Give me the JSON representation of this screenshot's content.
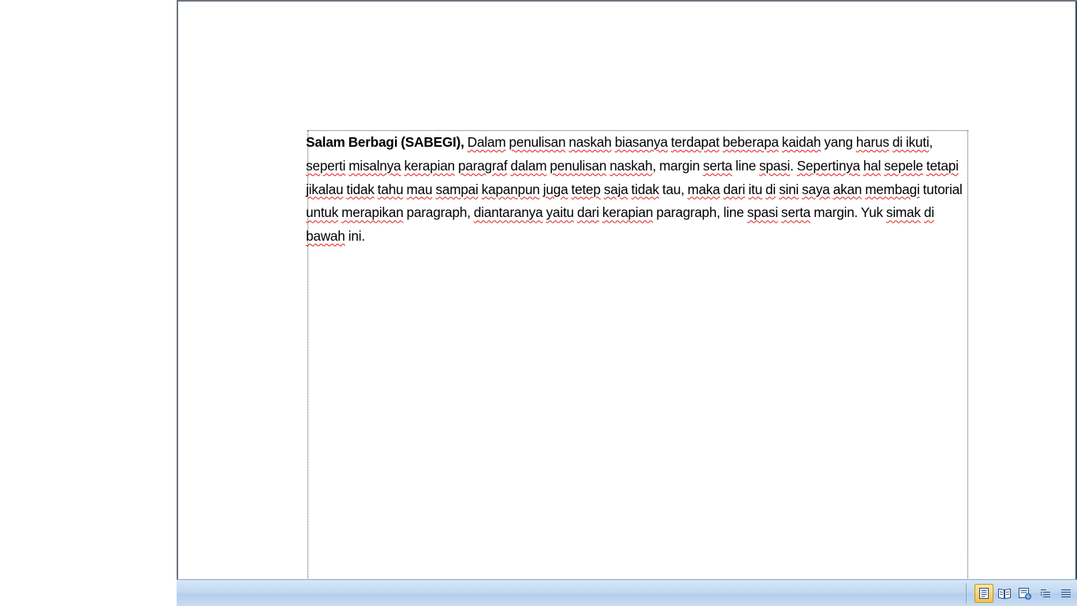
{
  "document": {
    "paragraph": {
      "bold_lead": "Salam Berbagi (SABEGI),",
      "words": [
        {
          "t": " ",
          "s": false
        },
        {
          "t": "Dalam",
          "s": true
        },
        {
          "t": " ",
          "s": false
        },
        {
          "t": "penulisan",
          "s": true
        },
        {
          "t": " ",
          "s": false
        },
        {
          "t": "naskah",
          "s": true
        },
        {
          "t": " ",
          "s": false
        },
        {
          "t": "biasanya",
          "s": true
        },
        {
          "t": " ",
          "s": false
        },
        {
          "t": "terdapat",
          "s": true
        },
        {
          "t": " ",
          "s": false
        },
        {
          "t": "beberapa",
          "s": true
        },
        {
          "t": " ",
          "s": false
        },
        {
          "t": "kaidah",
          "s": true
        },
        {
          "t": " yang ",
          "s": false
        },
        {
          "t": "harus",
          "s": true
        },
        {
          "t": " ",
          "s": false
        },
        {
          "t": "di ikuti",
          "s": true
        },
        {
          "t": ", ",
          "s": false
        },
        {
          "t": "seperti",
          "s": true
        },
        {
          "t": " ",
          "s": false
        },
        {
          "t": "misalnya",
          "s": true
        },
        {
          "t": " ",
          "s": false
        },
        {
          "t": "kerapian",
          "s": true
        },
        {
          "t": " ",
          "s": false
        },
        {
          "t": "paragraf",
          "s": true
        },
        {
          "t": " ",
          "s": false
        },
        {
          "t": "dalam",
          "s": true
        },
        {
          "t": " ",
          "s": false
        },
        {
          "t": "penulisan",
          "s": true
        },
        {
          "t": " ",
          "s": false
        },
        {
          "t": "naskah",
          "s": true
        },
        {
          "t": ", margin ",
          "s": false
        },
        {
          "t": "serta",
          "s": true
        },
        {
          "t": " line ",
          "s": false
        },
        {
          "t": "spasi",
          "s": true
        },
        {
          "t": ". ",
          "s": false
        },
        {
          "t": "Sepertinya",
          "s": true
        },
        {
          "t": " ",
          "s": false
        },
        {
          "t": "hal",
          "s": true
        },
        {
          "t": " ",
          "s": false
        },
        {
          "t": "sepele",
          "s": true
        },
        {
          "t": " ",
          "s": false
        },
        {
          "t": "tetapi",
          "s": true
        },
        {
          "t": " ",
          "s": false
        },
        {
          "t": "jikalau",
          "s": true
        },
        {
          "t": " ",
          "s": false
        },
        {
          "t": "tidak",
          "s": true
        },
        {
          "t": " ",
          "s": false
        },
        {
          "t": "tahu",
          "s": true
        },
        {
          "t": " ",
          "s": false
        },
        {
          "t": "mau",
          "s": true
        },
        {
          "t": " ",
          "s": false
        },
        {
          "t": "sampai",
          "s": true
        },
        {
          "t": " ",
          "s": false
        },
        {
          "t": "kapanpun",
          "s": true
        },
        {
          "t": " ",
          "s": false
        },
        {
          "t": "juga",
          "s": true
        },
        {
          "t": " ",
          "s": false
        },
        {
          "t": "tetep",
          "s": true
        },
        {
          "t": " ",
          "s": false
        },
        {
          "t": "saja",
          "s": true
        },
        {
          "t": " ",
          "s": false
        },
        {
          "t": "tidak",
          "s": true
        },
        {
          "t": " tau, ",
          "s": false
        },
        {
          "t": "maka",
          "s": true
        },
        {
          "t": " ",
          "s": false
        },
        {
          "t": "dari",
          "s": true
        },
        {
          "t": " ",
          "s": false
        },
        {
          "t": "itu",
          "s": true
        },
        {
          "t": " ",
          "s": false
        },
        {
          "t": "di",
          "s": true
        },
        {
          "t": " ",
          "s": false
        },
        {
          "t": "sini",
          "s": true
        },
        {
          "t": " ",
          "s": false
        },
        {
          "t": "saya",
          "s": true
        },
        {
          "t": " ",
          "s": false
        },
        {
          "t": "akan",
          "s": true
        },
        {
          "t": " ",
          "s": false
        },
        {
          "t": "membagi",
          "s": true
        },
        {
          "t": " tutorial ",
          "s": false
        },
        {
          "t": "untuk",
          "s": true
        },
        {
          "t": " ",
          "s": false
        },
        {
          "t": "merapikan",
          "s": true
        },
        {
          "t": " paragraph, ",
          "s": false
        },
        {
          "t": "diantaranya",
          "s": true
        },
        {
          "t": " ",
          "s": false
        },
        {
          "t": "yaitu",
          "s": true
        },
        {
          "t": " ",
          "s": false
        },
        {
          "t": "dari",
          "s": true
        },
        {
          "t": " ",
          "s": false
        },
        {
          "t": "kerapian",
          "s": true
        },
        {
          "t": " paragraph, line ",
          "s": false
        },
        {
          "t": "spasi",
          "s": true
        },
        {
          "t": " ",
          "s": false
        },
        {
          "t": "serta",
          "s": true
        },
        {
          "t": " margin. Yuk ",
          "s": false
        },
        {
          "t": "simak",
          "s": true
        },
        {
          "t": " ",
          "s": false
        },
        {
          "t": "di",
          "s": true
        },
        {
          "t": " ",
          "s": false
        },
        {
          "t": "bawah",
          "s": true
        },
        {
          "t": " ini.",
          "s": false
        }
      ]
    }
  },
  "statusbar": {
    "view_buttons": [
      {
        "name": "print-layout-view-icon",
        "active": true
      },
      {
        "name": "full-screen-reading-view-icon",
        "active": false
      },
      {
        "name": "web-layout-view-icon",
        "active": false
      },
      {
        "name": "outline-view-icon",
        "active": false
      },
      {
        "name": "draft-view-icon",
        "active": false
      }
    ]
  },
  "colors": {
    "spellcheck_underline": "#e0201b",
    "statusbar_bg": "#c3d9f2",
    "active_view_button": "#f7c24a"
  }
}
